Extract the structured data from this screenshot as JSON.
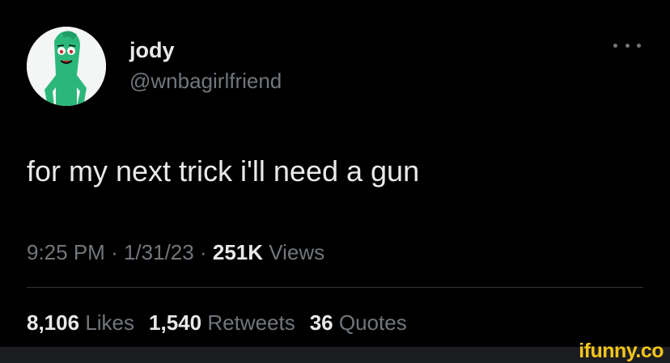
{
  "tweet": {
    "author_name": "jody",
    "author_handle": "@wnbagirlfriend",
    "text": "for my next trick i'll need a gun",
    "time": "9:25 PM",
    "separator": "·",
    "date": "1/31/23",
    "views_count": "251K",
    "views_label": "Views",
    "likes_count": "8,106",
    "likes_label": "Likes",
    "retweets_count": "1,540",
    "retweets_label": "Retweets",
    "quotes_count": "36",
    "quotes_label": "Quotes",
    "more_icon": "more-horizontal-icon"
  },
  "watermark": {
    "text": "ifunny.co"
  },
  "colors": {
    "background": "#000000",
    "primary_text": "#e7e9ea",
    "secondary_text": "#71767b",
    "divider": "#2f3336",
    "watermark": "#f4c51b",
    "avatar_green": "#2cb77a"
  }
}
